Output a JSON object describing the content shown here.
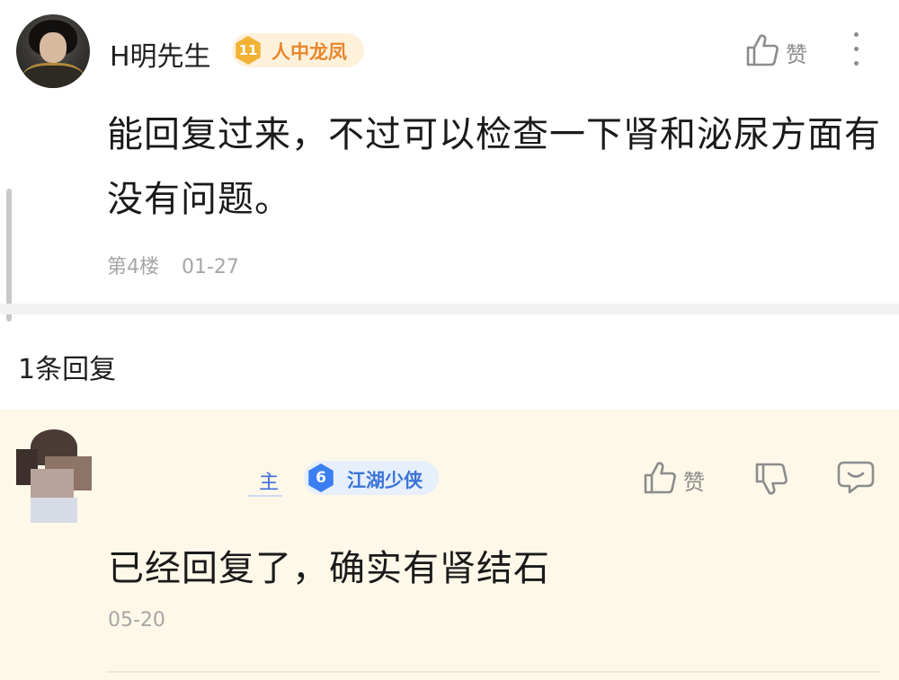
{
  "post": {
    "username": "H明先生",
    "badge": {
      "level": "11",
      "title": "人中龙凤"
    },
    "like_label": "赞",
    "content": "能回复过来，不过可以检查一下肾和泌尿方面有没有问题。",
    "floor": "第4楼",
    "date": "01-27"
  },
  "replies_header": {
    "count_label": "1条回复"
  },
  "reply": {
    "username": "主",
    "badge": {
      "level": "6",
      "title": "江湖少侠"
    },
    "like_label": "赞",
    "content": "已经回复了，确实有肾结石",
    "time": "05-20"
  },
  "icons": {
    "post_avatar": "avatar-image",
    "like": "thumbs-up-icon",
    "more": "more-vertical-icon",
    "dislike": "thumbs-down-icon",
    "comment": "comment-bubble-icon"
  },
  "colors": {
    "gold_badge": "#f2b234",
    "gold_badge_text": "#e8862b",
    "blue_badge": "#3b7ff0",
    "reply_background": "#fdf8e8",
    "meta_gray": "#a6a6a6"
  }
}
